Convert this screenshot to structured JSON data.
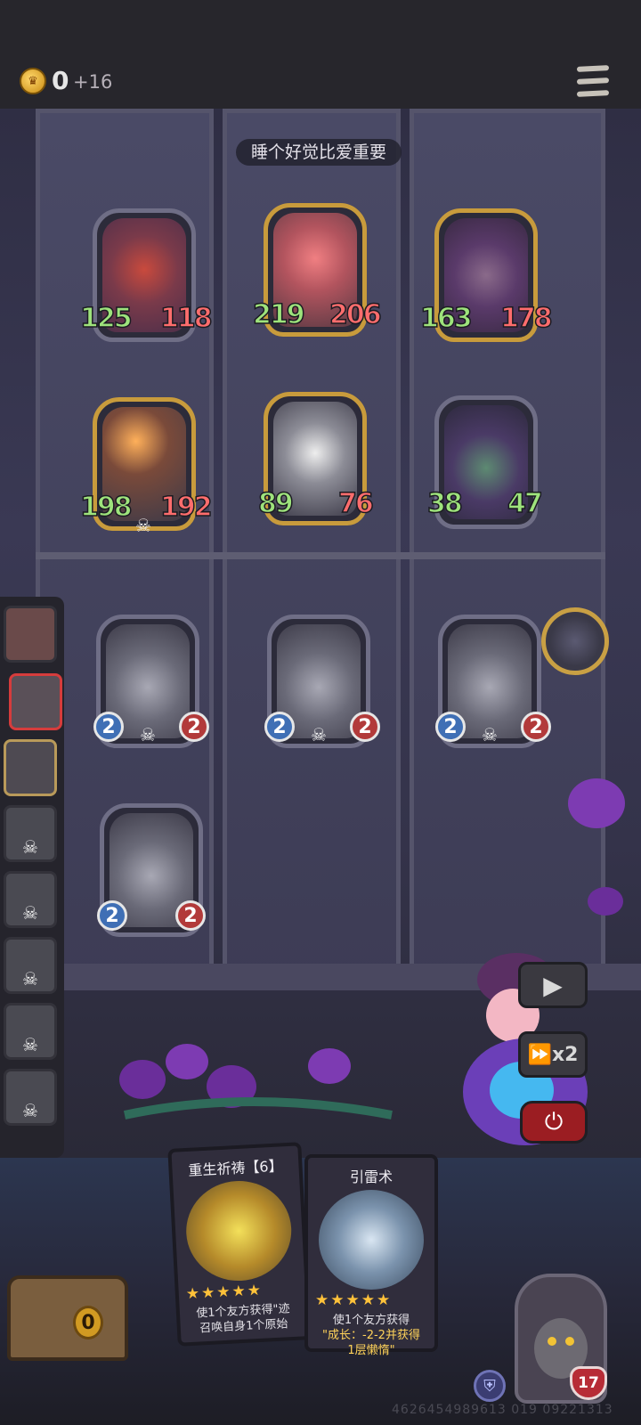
{
  "hud": {
    "gold": "0",
    "gold_income": "+16"
  },
  "battle": {
    "subtitle": "睡个好觉比爱重要"
  },
  "enemies": [
    {
      "atk": "125",
      "hp": "118"
    },
    {
      "atk": "219",
      "hp": "206"
    },
    {
      "atk": "163",
      "hp": "178"
    },
    {
      "atk": "198",
      "hp": "192"
    },
    {
      "atk": "89",
      "hp": "76"
    },
    {
      "atk": "38",
      "hp": "47"
    }
  ],
  "allies": [
    {
      "atk": "2",
      "hp": "2"
    },
    {
      "atk": "2",
      "hp": "2"
    },
    {
      "atk": "2",
      "hp": "2"
    },
    {
      "atk": "2",
      "hp": "2"
    }
  ],
  "controls": {
    "speed_label": "x2"
  },
  "hand": [
    {
      "title": "重生祈祷【6】",
      "stars": "★★★★★",
      "desc_line1": "使1个友方获得\"迹",
      "desc_line2": "召唤自身1个原始"
    },
    {
      "title": "引雷术",
      "stars": "★★★★★",
      "desc_line1": "使1个友方获得",
      "desc_line2_hl": "\"成长：-2-2并获得",
      "desc_line3_hl": "1层懒惰\""
    }
  ],
  "chest": {
    "count": "0"
  },
  "hero": {
    "hp": "17"
  },
  "watermark": "4626454989613 019 09221313",
  "icons": {
    "coin": "crown-coin-icon",
    "menu": "hamburger-menu-icon",
    "play": "play-icon",
    "speed": "fast-forward-icon",
    "power": "power-icon",
    "shield": "shield-icon",
    "skull": "skull-icon"
  },
  "colors": {
    "attack": "#9ee37c",
    "health": "#ff6d6d",
    "gold_frame": "#c89b3c",
    "power_button": "#9b1d22"
  }
}
